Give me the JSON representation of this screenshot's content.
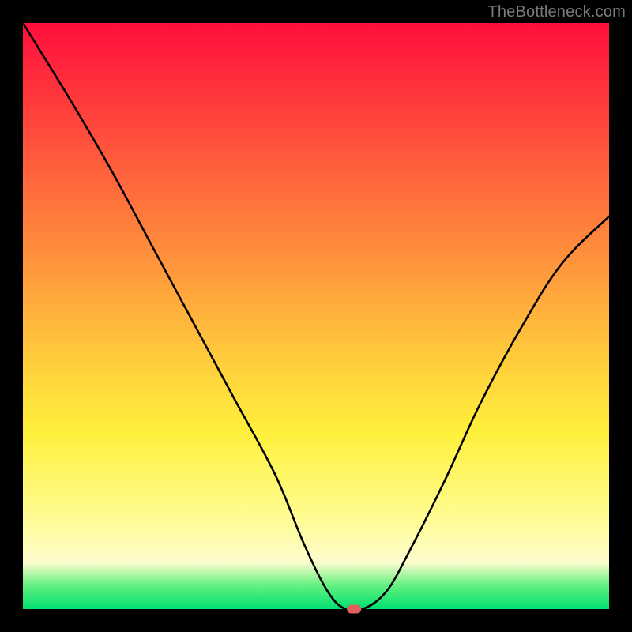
{
  "watermark": "TheBottleneck.com",
  "chart_data": {
    "type": "line",
    "title": "",
    "xlabel": "",
    "ylabel": "",
    "xlim": [
      0,
      100
    ],
    "ylim": [
      0,
      100
    ],
    "grid": false,
    "x": [
      0,
      8,
      15,
      22,
      29,
      36,
      43,
      48,
      52,
      55,
      58,
      62,
      66,
      72,
      78,
      85,
      92,
      100
    ],
    "y": [
      100,
      87,
      75,
      62,
      49,
      36,
      23,
      11,
      3,
      0,
      0,
      3,
      10,
      22,
      35,
      48,
      59,
      67
    ],
    "marker": {
      "x": 56.5,
      "y": 0
    }
  },
  "colors": {
    "gradient_top": "#ff0e3c",
    "gradient_bottom": "#00e070",
    "curve": "#000000",
    "marker": "#e06060",
    "frame": "#000000"
  }
}
